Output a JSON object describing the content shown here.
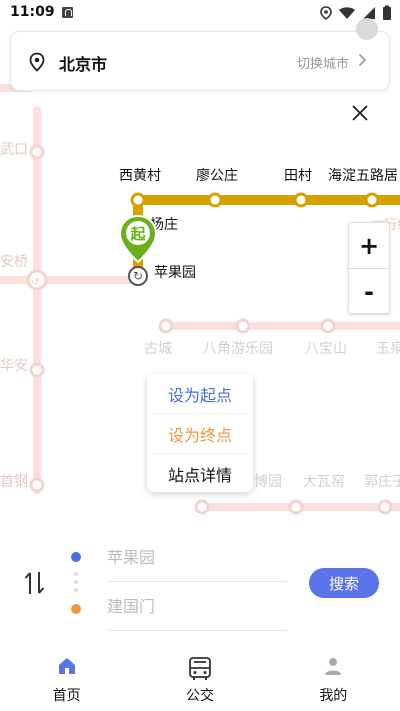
{
  "status_bar": {
    "time": "11:09"
  },
  "city_bar": {
    "city": "北京市",
    "switch_label": "切换城市"
  },
  "map": {
    "line_color": "#d8a000",
    "faint_line_color": "#f7d9d4",
    "stations_main": [
      "西黄村",
      "廖公庄",
      "田村",
      "海淀五路居"
    ],
    "station_yangzhuang": "杨庄",
    "station_current": "苹果园",
    "stations_lower": [
      "古城",
      "八角游乐园",
      "八宝山",
      "玉泉"
    ],
    "stations_bottom": [
      "博园",
      "大瓦窑",
      "郭庄子"
    ],
    "side_labels": [
      "武口",
      "安桥",
      "华安",
      "首钢"
    ],
    "start_marker": "起"
  },
  "zoom": {
    "in": "+",
    "out": "-"
  },
  "popup": {
    "set_start": "设为起点",
    "set_end": "设为终点",
    "station_detail": "站点详情"
  },
  "route": {
    "from": "苹果园",
    "to": "建国门",
    "search": "搜索"
  },
  "nav": [
    {
      "label": "首页",
      "icon": "home-icon",
      "active": true
    },
    {
      "label": "公交",
      "icon": "bus-icon",
      "active": false
    },
    {
      "label": "我的",
      "icon": "user-icon",
      "active": false
    }
  ]
}
